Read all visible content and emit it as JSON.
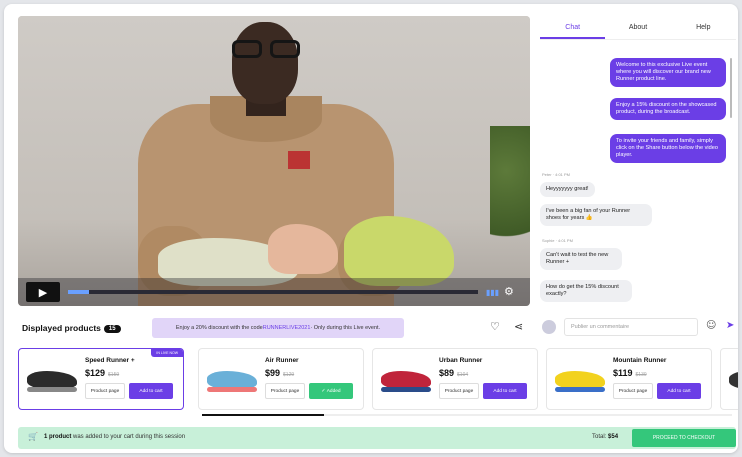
{
  "chat_tabs": [
    "Chat",
    "About",
    "Help"
  ],
  "bot_messages": [
    "Welcome to this exclusive Live event where you will discover our brand new Runner product line.",
    "Enjoy a 15% discount on the showcased product, during the broadcast.",
    "To invite your friends and family, simply click on the Share button below the video player."
  ],
  "user_messages": [
    {
      "meta": "Peter · 4:01 PM",
      "text": "Heyyyyyyy great!"
    },
    {
      "meta": "",
      "text": "I've been a big fan of your Runner shoes for years 👍"
    },
    {
      "meta": "Sophie · 4:01 PM",
      "text": "Can't wait to test the new Runner +"
    },
    {
      "meta": "",
      "text": "How do get the 15% discount exactly?"
    }
  ],
  "displayed_products": {
    "label": "Displayed products",
    "count": "15"
  },
  "promo": {
    "prefix": "Enjoy a 20% discount with the code ",
    "code": "RUNNERLIVE2021",
    "suffix": " · Only during this Live event."
  },
  "comment_placeholder": "Publier un commentaire",
  "products": [
    {
      "name": "Speed Runner +",
      "price": "$129",
      "old": "$159",
      "badge": "IN LIVE NOW",
      "product_page": "Product page",
      "add": "Add to cart",
      "colors": [
        "#2b2b2b",
        "#555"
      ]
    },
    {
      "name": "Air Runner",
      "price": "$99",
      "old": "$129",
      "product_page": "Product page",
      "add": "Added",
      "colors": [
        "#6ab0d8",
        "#e77"
      ]
    },
    {
      "name": "Urban Runner",
      "price": "$89",
      "old": "$104",
      "product_page": "Product page",
      "add": "Add to cart",
      "colors": [
        "#c0243b",
        "#2a4c8a"
      ]
    },
    {
      "name": "Mountain Runner",
      "price": "$119",
      "old": "$139",
      "product_page": "Product page",
      "add": "Add to cart",
      "colors": [
        "#f2d21e",
        "#3a6fc8"
      ]
    }
  ],
  "footer": {
    "count": "1 product",
    "text": " was added to your cart during this session",
    "total_label": "Total: ",
    "total": "$54",
    "checkout": "PROCEED TO CHECKOUT"
  },
  "video": {
    "progress": 0.05
  },
  "accent": "#6b3ee6"
}
